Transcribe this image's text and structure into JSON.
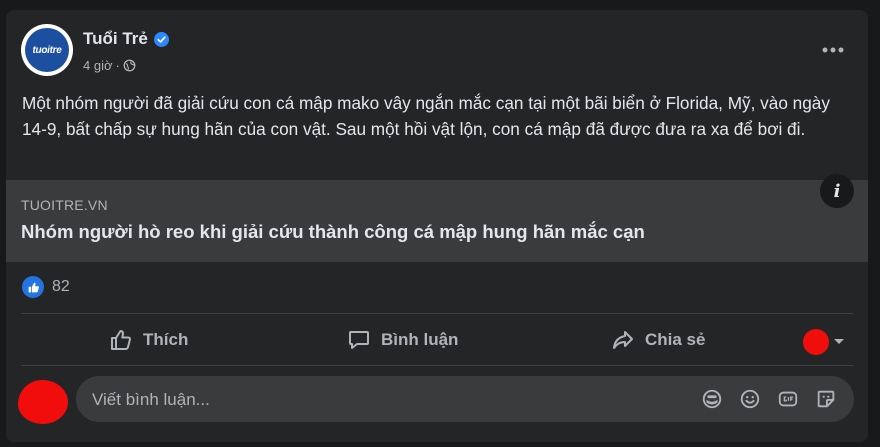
{
  "post": {
    "page_name": "Tuổi Trẻ",
    "avatar_text": "tuoitre",
    "time": "4 giờ",
    "separator": "·",
    "text": "Một nhóm người đã giải cứu con cá mập mako vây ngắn mắc cạn tại một bãi biển ở Florida, Mỹ, vào ngày 14-9, bất chấp sự hung hãn của con vật. Sau một hồi vật lộn, con cá mập đã được đưa ra xa để bơi đi."
  },
  "link": {
    "domain": "TUOITRE.VN",
    "title": "Nhóm người hò reo khi giải cứu thành công cá mập hung hãn mắc cạn",
    "info_glyph": "i"
  },
  "reactions": {
    "count": "82"
  },
  "actions": {
    "like_label": "Thích",
    "comment_label": "Bình luận",
    "share_label": "Chia sẻ"
  },
  "comment": {
    "placeholder": "Viết bình luận..."
  },
  "colors": {
    "background": "#18191a",
    "card": "#242526",
    "link_card": "#3a3b3c",
    "accent_blue": "#2374e1",
    "redaction": "#f20d0d"
  },
  "icons": [
    "verified-icon",
    "globe-icon",
    "more-icon",
    "info-icon",
    "like-reaction-icon",
    "like-icon",
    "comment-icon",
    "share-icon",
    "chevron-down-icon",
    "sticker-icon",
    "emoji-icon",
    "gif-icon",
    "avatar-sticker-icon"
  ]
}
